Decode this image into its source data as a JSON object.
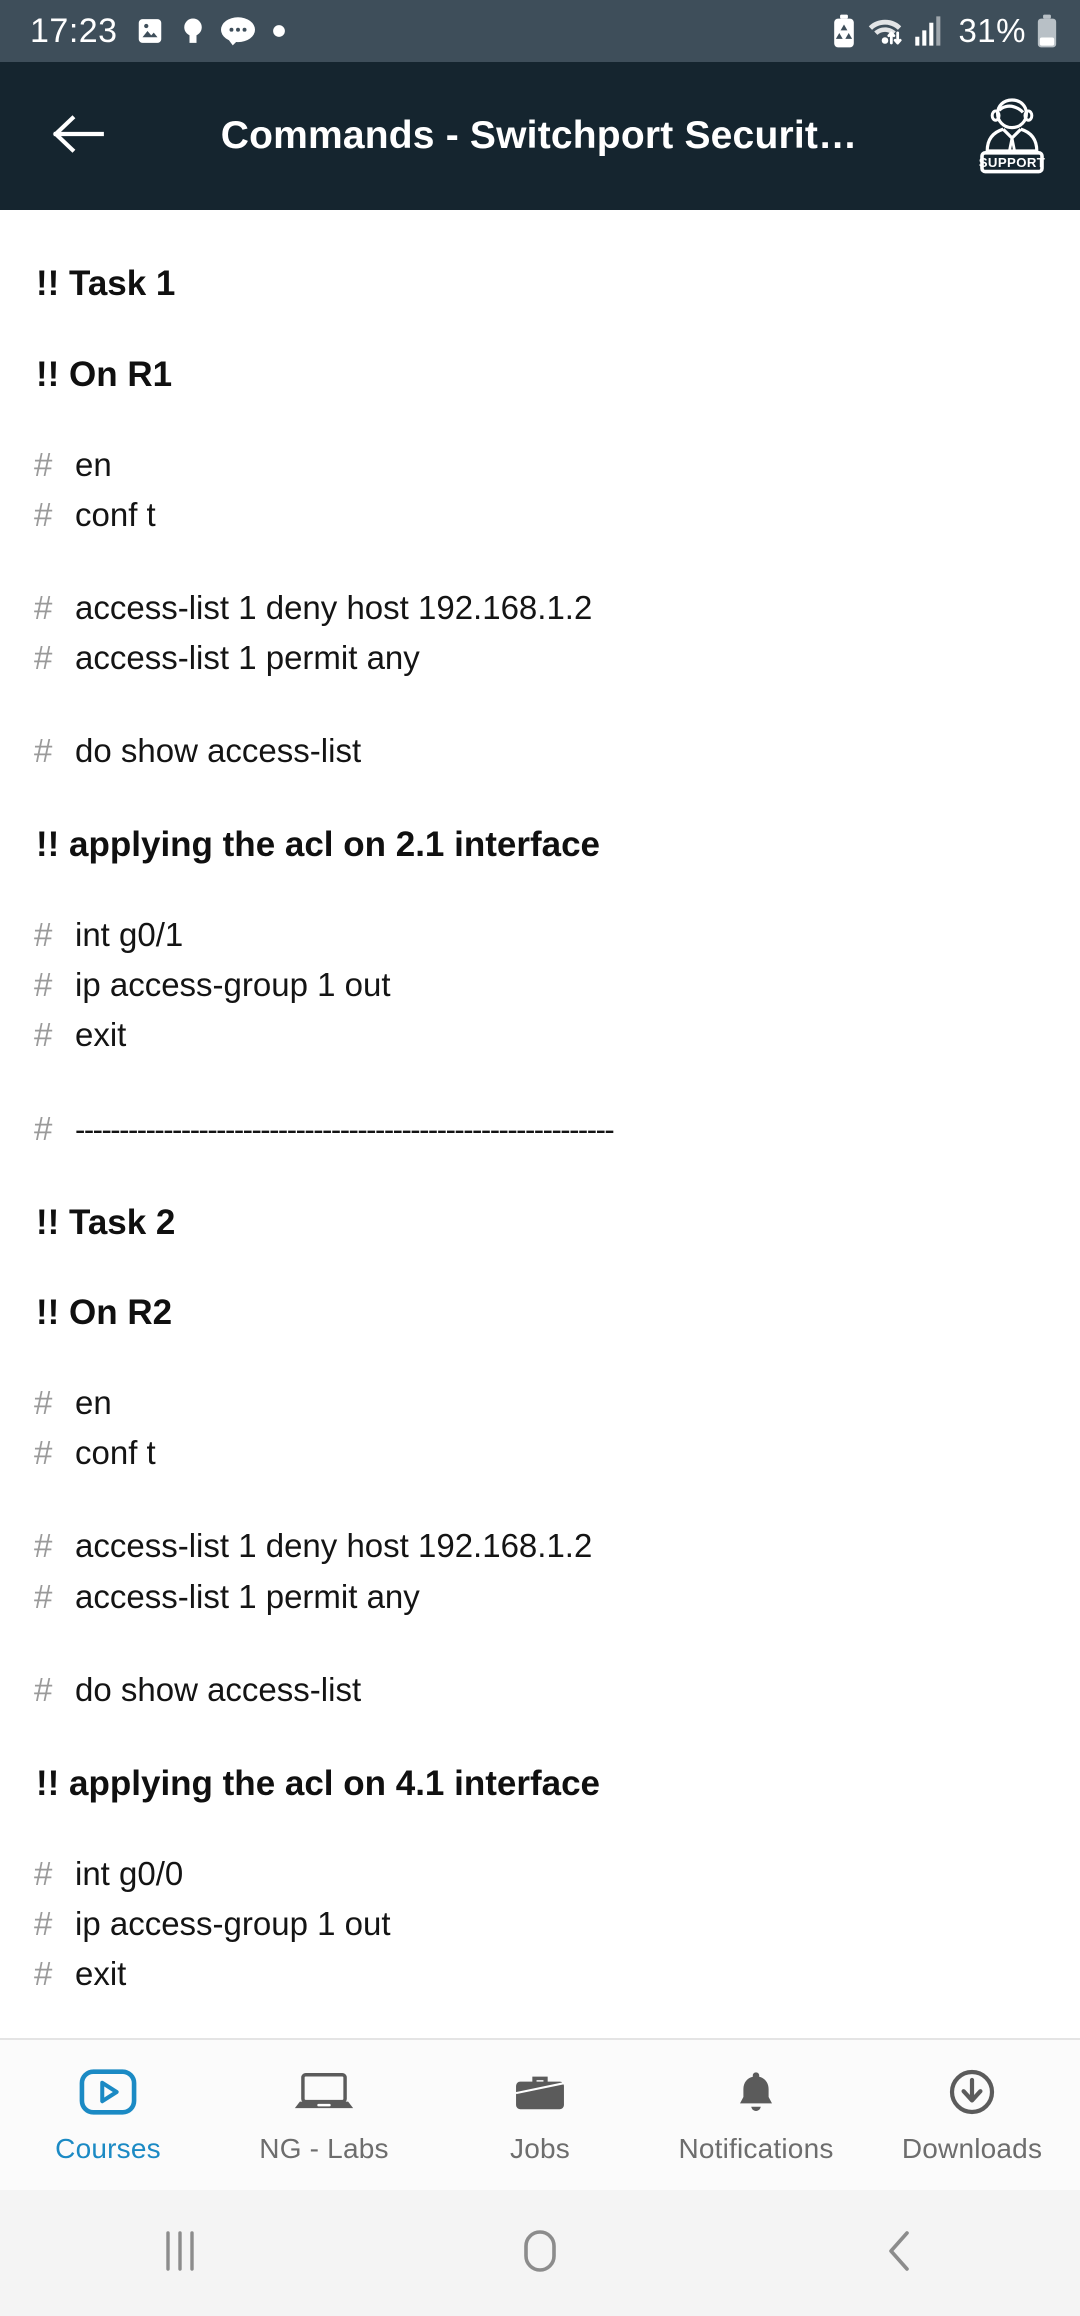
{
  "status_bar": {
    "time": "17:23",
    "battery_percent": "31%",
    "left_icons": [
      "image-icon",
      "bulb-icon",
      "chat-bubble-icon",
      "dot-icon"
    ],
    "right_icons": [
      "battery-saver-icon",
      "wifi-icon",
      "signal-icon",
      "battery-icon"
    ],
    "background_color": "#3e4e5a"
  },
  "app_bar": {
    "back_icon": "back-arrow-icon",
    "title": "Commands - Switchport Securit…",
    "support_icon": "support-agent-icon",
    "support_label": "SUPPORT",
    "background_color": "#15252f"
  },
  "content": {
    "blocks": [
      {
        "type": "heading",
        "text": "!! Task 1"
      },
      {
        "type": "heading",
        "text": "!! On R1"
      },
      {
        "type": "commands",
        "lines": [
          "en",
          "conf t"
        ]
      },
      {
        "type": "commands",
        "lines": [
          "access-list 1 deny host 192.168.1.2",
          "access-list 1 permit any"
        ]
      },
      {
        "type": "commands",
        "lines": [
          "do show access-list"
        ]
      },
      {
        "type": "heading",
        "text": "!! applying the acl on 2.1 interface"
      },
      {
        "type": "commands",
        "lines": [
          "int g0/1",
          "ip access-group 1 out",
          "exit"
        ]
      },
      {
        "type": "rule",
        "text": "-------------------------------------------------------------"
      },
      {
        "type": "heading",
        "text": "!! Task 2"
      },
      {
        "type": "heading",
        "text": "!! On R2"
      },
      {
        "type": "commands",
        "lines": [
          "en",
          "conf t"
        ]
      },
      {
        "type": "commands",
        "lines": [
          "access-list 1 deny host 192.168.1.2",
          "access-list 1 permit any"
        ]
      },
      {
        "type": "commands",
        "lines": [
          "do show access-list"
        ]
      },
      {
        "type": "heading",
        "text": "!! applying the acl on 4.1 interface"
      },
      {
        "type": "commands",
        "lines": [
          "int g0/0",
          "ip access-group 1 out",
          "exit"
        ]
      },
      {
        "type": "rule",
        "text": "-------------------------------------------------------------"
      }
    ],
    "prompt_symbol": "#",
    "prompt_color": "#9a9a9a",
    "text_color": "#141414"
  },
  "tab_bar": {
    "active_color": "#1b8ac4",
    "inactive_color": "#6d6d6d",
    "tabs": [
      {
        "label": "Courses",
        "icon": "play-video-icon",
        "active": true
      },
      {
        "label": "NG - Labs",
        "icon": "laptop-icon",
        "active": false
      },
      {
        "label": "Jobs",
        "icon": "briefcase-icon",
        "active": false
      },
      {
        "label": "Notifications",
        "icon": "bell-icon",
        "active": false
      },
      {
        "label": "Downloads",
        "icon": "download-circle-icon",
        "active": false
      }
    ]
  },
  "nav_bar": {
    "buttons": [
      {
        "name": "recents-icon"
      },
      {
        "name": "home-icon"
      },
      {
        "name": "back-icon"
      }
    ]
  }
}
